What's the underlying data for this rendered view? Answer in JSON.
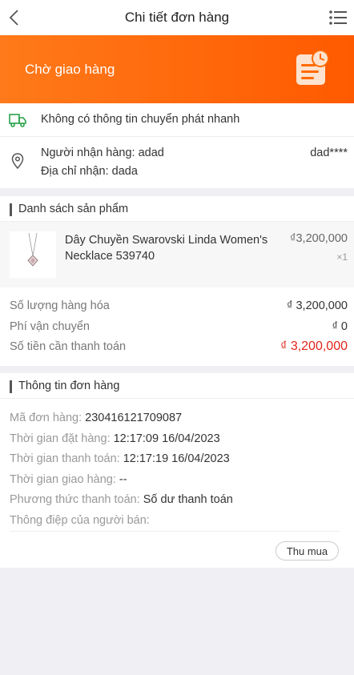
{
  "header": {
    "title": "Chi tiết đơn hàng",
    "back_icon": "chevron-left-icon",
    "menu_icon": "list-menu-icon"
  },
  "status": {
    "text": "Chờ giao hàng",
    "icon": "order-clock-icon",
    "colors": {
      "gradient_start": "#ff7a1a",
      "gradient_end": "#ff5a00"
    }
  },
  "shipping": {
    "express_text": "Không có thông tin chuyển phát nhanh",
    "recipient_label": "Người nhận hàng:",
    "recipient_value": "adad",
    "address_label": "Địa chỉ nhận:",
    "address_value": "dada",
    "phone": "dad****"
  },
  "products": {
    "section_title": "Danh sách sản phẩm",
    "items": [
      {
        "name": "Dây Chuyền Swarovski Linda Women's Necklace 539740",
        "price": "₫3,200,000",
        "qty": "×1"
      }
    ],
    "summary": {
      "quantity_label": "Số lượng hàng hóa",
      "quantity_value": "₫ 3,200,000",
      "shipping_label": "Phí vận chuyển",
      "shipping_value": "₫ 0",
      "total_label": "Số tiền cần thanh toán",
      "total_value": "₫ 3,200,000"
    }
  },
  "order_info": {
    "section_title": "Thông tin đơn hàng",
    "order_id_label": "Mã đơn hàng:",
    "order_id_value": "230416121709087",
    "order_time_label": "Thời gian đặt hàng:",
    "order_time_value": "12:17:09 16/04/2023",
    "pay_time_label": "Thời gian thanh toán:",
    "pay_time_value": "12:17:19 16/04/2023",
    "delivery_time_label": "Thời gian giao hàng:",
    "delivery_time_value": "--",
    "pay_method_label": "Phương thức thanh toán:",
    "pay_method_value": "Số dư thanh toán",
    "seller_msg_label": "Thông điệp của người bán:",
    "buy_again_label": "Thu mua"
  },
  "accent_colors": {
    "price_red": "#e1251b",
    "truck_green": "#2aa24a"
  }
}
